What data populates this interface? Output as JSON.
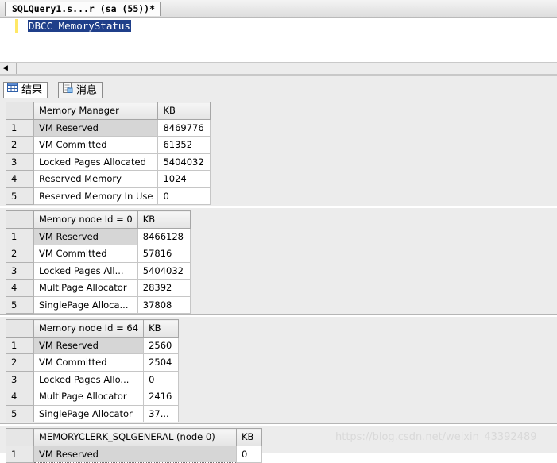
{
  "editor": {
    "tab_title": "SQLQuery1.s...r (sa (55))*",
    "query_text": "DBCC MemoryStatus"
  },
  "results_tabs": [
    {
      "label": "结果",
      "icon": "grid-icon"
    },
    {
      "label": "消息",
      "icon": "messages-icon"
    }
  ],
  "grids": [
    {
      "headers": [
        "Memory Manager",
        "KB"
      ],
      "rows": [
        [
          "1",
          "VM Reserved",
          "8469776"
        ],
        [
          "2",
          "VM Committed",
          "61352"
        ],
        [
          "3",
          "Locked Pages Allocated",
          "5404032"
        ],
        [
          "4",
          "Reserved Memory",
          "1024"
        ],
        [
          "5",
          "Reserved Memory In Use",
          "0"
        ]
      ]
    },
    {
      "headers": [
        "Memory node Id = 0",
        "KB"
      ],
      "rows": [
        [
          "1",
          "VM Reserved",
          "8466128"
        ],
        [
          "2",
          "VM Committed",
          "57816"
        ],
        [
          "3",
          "Locked Pages All...",
          "5404032"
        ],
        [
          "4",
          "MultiPage Allocator",
          "28392"
        ],
        [
          "5",
          "SinglePage Alloca...",
          "37808"
        ]
      ]
    },
    {
      "headers": [
        "Memory node Id = 64",
        "KB"
      ],
      "rows": [
        [
          "1",
          "VM Reserved",
          "2560"
        ],
        [
          "2",
          "VM Committed",
          "2504"
        ],
        [
          "3",
          "Locked Pages Allo...",
          "0"
        ],
        [
          "4",
          "MultiPage Allocator",
          "2416"
        ],
        [
          "5",
          "SinglePage Allocator",
          "37..."
        ]
      ]
    },
    {
      "headers": [
        "MEMORYCLERK_SQLGENERAL (node 0)",
        "KB"
      ],
      "rows": [
        [
          "1",
          "VM Reserved",
          "0"
        ]
      ]
    }
  ],
  "watermark": "https://blog.csdn.net/weixin_43392489"
}
